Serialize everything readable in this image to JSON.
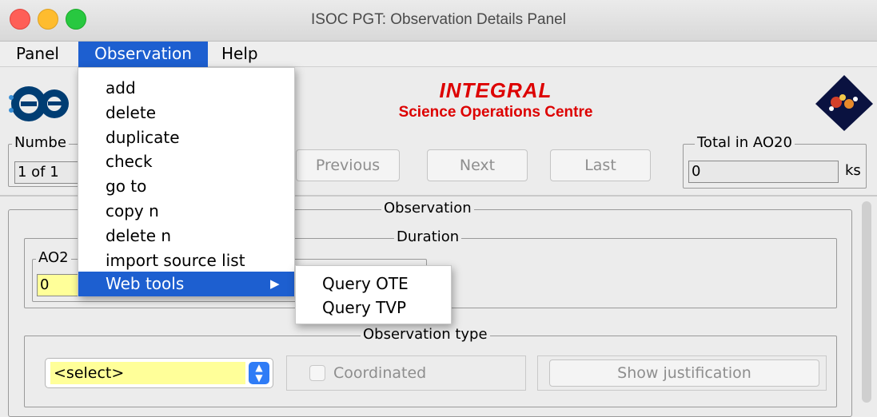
{
  "window": {
    "title": "ISOC PGT: Observation Details Panel"
  },
  "menubar": {
    "panel": "Panel",
    "observation": "Observation",
    "help": "Help"
  },
  "header": {
    "title": "INTEGRAL",
    "subtitle": "Science Operations Centre"
  },
  "navigation": {
    "number_label": "Numbe",
    "number_value": "1 of 1",
    "previous": "Previous",
    "next": "Next",
    "last": "Last",
    "total_label": "Total in AO20",
    "total_value": "0",
    "total_unit": "ks"
  },
  "observation_panel": {
    "title": "Observation",
    "duration_title": "Duration",
    "ao_label": "AO2",
    "ao_value": "0",
    "type_title": "Observation type",
    "type_select": "<select>",
    "coordinated_label": "Coordinated",
    "show_justification": "Show justification"
  },
  "observation_menu": {
    "items": [
      "add",
      "delete",
      "duplicate",
      "check",
      "go to",
      "copy n",
      "delete n",
      "import source list",
      "Web tools"
    ]
  },
  "web_tools_submenu": {
    "items": [
      "Query OTE",
      "Query TVP"
    ]
  },
  "colors": {
    "accent": "#1d5fd0",
    "brand_red": "#dd0000",
    "field_yellow": "#ffff99"
  }
}
